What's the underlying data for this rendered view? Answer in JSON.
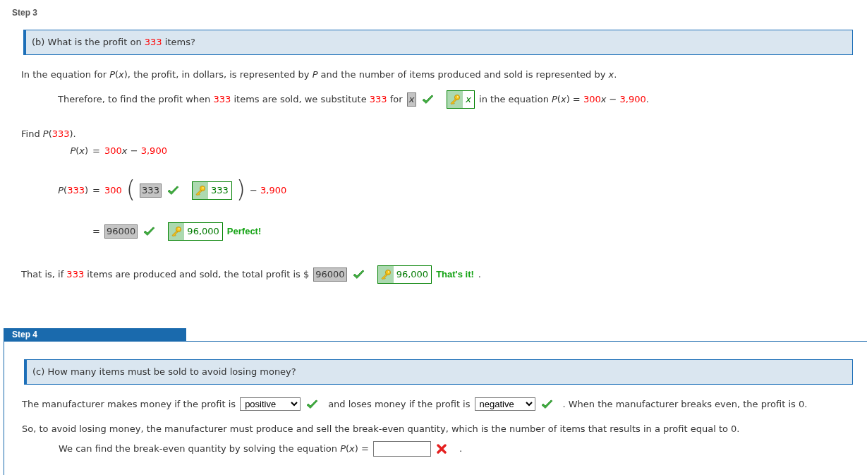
{
  "step3": {
    "title": "Step 3",
    "question": [
      {
        "text": "(b) What is the profit on "
      },
      {
        "text": "333",
        "kind": "given"
      },
      {
        "text": " items?"
      }
    ],
    "intro": [
      {
        "text": "In the equation for "
      },
      {
        "text": "P",
        "kind": "var"
      },
      {
        "text": "("
      },
      {
        "text": "x",
        "kind": "var"
      },
      {
        "text": "), the profit, in dollars, is represented by "
      },
      {
        "text": "P",
        "kind": "var"
      },
      {
        "text": " and the number of items produced and sold is represented by "
      },
      {
        "text": "x",
        "kind": "var"
      },
      {
        "text": "."
      }
    ],
    "substitute": [
      {
        "kind": "text",
        "runs": [
          {
            "text": "Therefore, to find the profit when "
          },
          {
            "text": "333",
            "kind": "given"
          },
          {
            "text": " items are sold, we substitute "
          },
          {
            "text": "333",
            "kind": "given"
          },
          {
            "text": " for"
          }
        ]
      },
      {
        "kind": "answer",
        "value": "x",
        "italic": true,
        "correct": true
      },
      {
        "kind": "key",
        "value": "x",
        "italic": true
      },
      {
        "kind": "text",
        "runs": [
          {
            "text": "in the equation "
          },
          {
            "text": "P",
            "kind": "var"
          },
          {
            "text": "("
          },
          {
            "text": "x",
            "kind": "var"
          },
          {
            "text": ") = "
          },
          {
            "text": "300",
            "kind": "given"
          },
          {
            "text": "x",
            "kind": "var"
          },
          {
            "text": " − "
          },
          {
            "text": "3,900",
            "kind": "given"
          },
          {
            "text": "."
          }
        ]
      }
    ],
    "find": [
      {
        "text": "Find "
      },
      {
        "text": "P",
        "kind": "var"
      },
      {
        "text": "("
      },
      {
        "text": "333",
        "kind": "given"
      },
      {
        "text": ")."
      }
    ],
    "equations": [
      {
        "lhs": [
          {
            "text": "P",
            "kind": "var"
          },
          {
            "text": "("
          },
          {
            "text": "x",
            "kind": "var"
          },
          {
            "text": ")"
          }
        ],
        "sign": "=",
        "rhs": [
          {
            "kind": "text",
            "runs": [
              {
                "text": "300",
                "kind": "given"
              },
              {
                "text": "x",
                "kind": "var"
              },
              {
                "text": " − "
              },
              {
                "text": "3,900",
                "kind": "given"
              }
            ]
          }
        ]
      },
      {
        "lhs": [
          {
            "text": "P",
            "kind": "var"
          },
          {
            "text": "("
          },
          {
            "text": "333",
            "kind": "given"
          },
          {
            "text": ")"
          }
        ],
        "sign": "=",
        "rhs": [
          {
            "kind": "text",
            "runs": [
              {
                "text": "300",
                "kind": "given"
              }
            ]
          },
          {
            "kind": "paren",
            "text": "("
          },
          {
            "kind": "answer",
            "value": "333",
            "correct": true
          },
          {
            "kind": "key",
            "value": "333"
          },
          {
            "kind": "paren",
            "text": ")"
          },
          {
            "kind": "text",
            "runs": [
              {
                "text": "− "
              },
              {
                "text": "3,900",
                "kind": "given"
              }
            ]
          }
        ]
      },
      {
        "sign": "=",
        "rhs": [
          {
            "kind": "answer",
            "value": "96000",
            "correct": true
          },
          {
            "kind": "key",
            "value": "96,000"
          },
          {
            "kind": "feedback",
            "text": "Perfect!"
          }
        ]
      }
    ],
    "conclusion": [
      {
        "kind": "text",
        "runs": [
          {
            "text": "That is, if "
          },
          {
            "text": "333",
            "kind": "given"
          },
          {
            "text": " items are produced and sold, the total profit is $"
          }
        ]
      },
      {
        "kind": "answer",
        "value": "96000",
        "correct": true
      },
      {
        "kind": "key",
        "value": "96,000"
      },
      {
        "kind": "feedback",
        "text": "That's it!"
      },
      {
        "kind": "text",
        "runs": [
          {
            "text": "."
          }
        ]
      }
    ]
  },
  "step4": {
    "title": "Step 4",
    "question": [
      {
        "text": "(c) How many items must be sold to avoid losing money?"
      }
    ],
    "sign_line": [
      {
        "kind": "text",
        "runs": [
          {
            "text": "The manufacturer makes money if the profit is"
          }
        ]
      },
      {
        "kind": "select",
        "value": "positive",
        "correct": true
      },
      {
        "kind": "text",
        "runs": [
          {
            "text": "and loses money if the profit is"
          }
        ]
      },
      {
        "kind": "select",
        "value": "negative",
        "correct": true
      },
      {
        "kind": "text",
        "runs": [
          {
            "text": ". When the manufacturer breaks even, the profit is 0."
          }
        ]
      }
    ],
    "breakeven": [
      {
        "text": "So, to avoid losing money, the manufacturer must produce and sell the break-even quantity, which is the number of items that results in a profit equal to 0."
      }
    ],
    "solve": [
      {
        "kind": "text",
        "runs": [
          {
            "text": "We can find the break-even quantity by solving the equation "
          },
          {
            "text": "P",
            "kind": "var"
          },
          {
            "text": "("
          },
          {
            "text": "x",
            "kind": "var"
          },
          {
            "text": ") ="
          }
        ]
      },
      {
        "kind": "blank",
        "correct": false
      },
      {
        "kind": "text",
        "runs": [
          {
            "text": "."
          }
        ]
      }
    ]
  }
}
